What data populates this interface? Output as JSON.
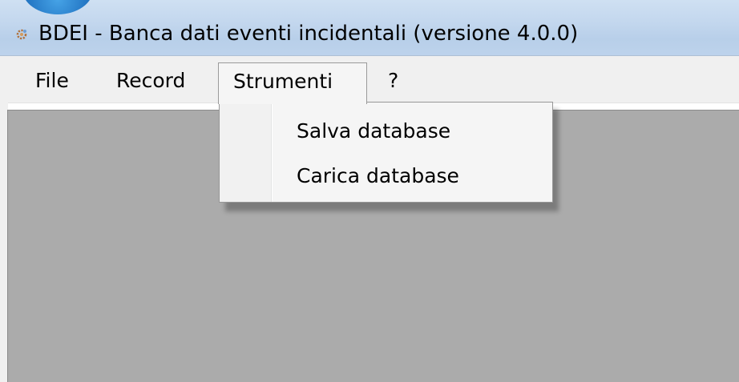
{
  "window": {
    "title": "BDEI - Banca dati eventi incidentali (versione 4.0.0)",
    "app_icon": "gear-app-icon"
  },
  "menubar": {
    "items": [
      {
        "label": "File"
      },
      {
        "label": "Record"
      },
      {
        "label": "Strumenti",
        "state": "open"
      },
      {
        "label": "?"
      }
    ]
  },
  "dropdown": {
    "parent": "Strumenti",
    "items": [
      {
        "label": "Salva database"
      },
      {
        "label": "Carica database"
      }
    ]
  },
  "colors": {
    "titlebar": "#c3d7ee",
    "menubar": "#f0f0f0",
    "client_area": "#ababab",
    "dropdown_bg": "#f5f5f5"
  }
}
